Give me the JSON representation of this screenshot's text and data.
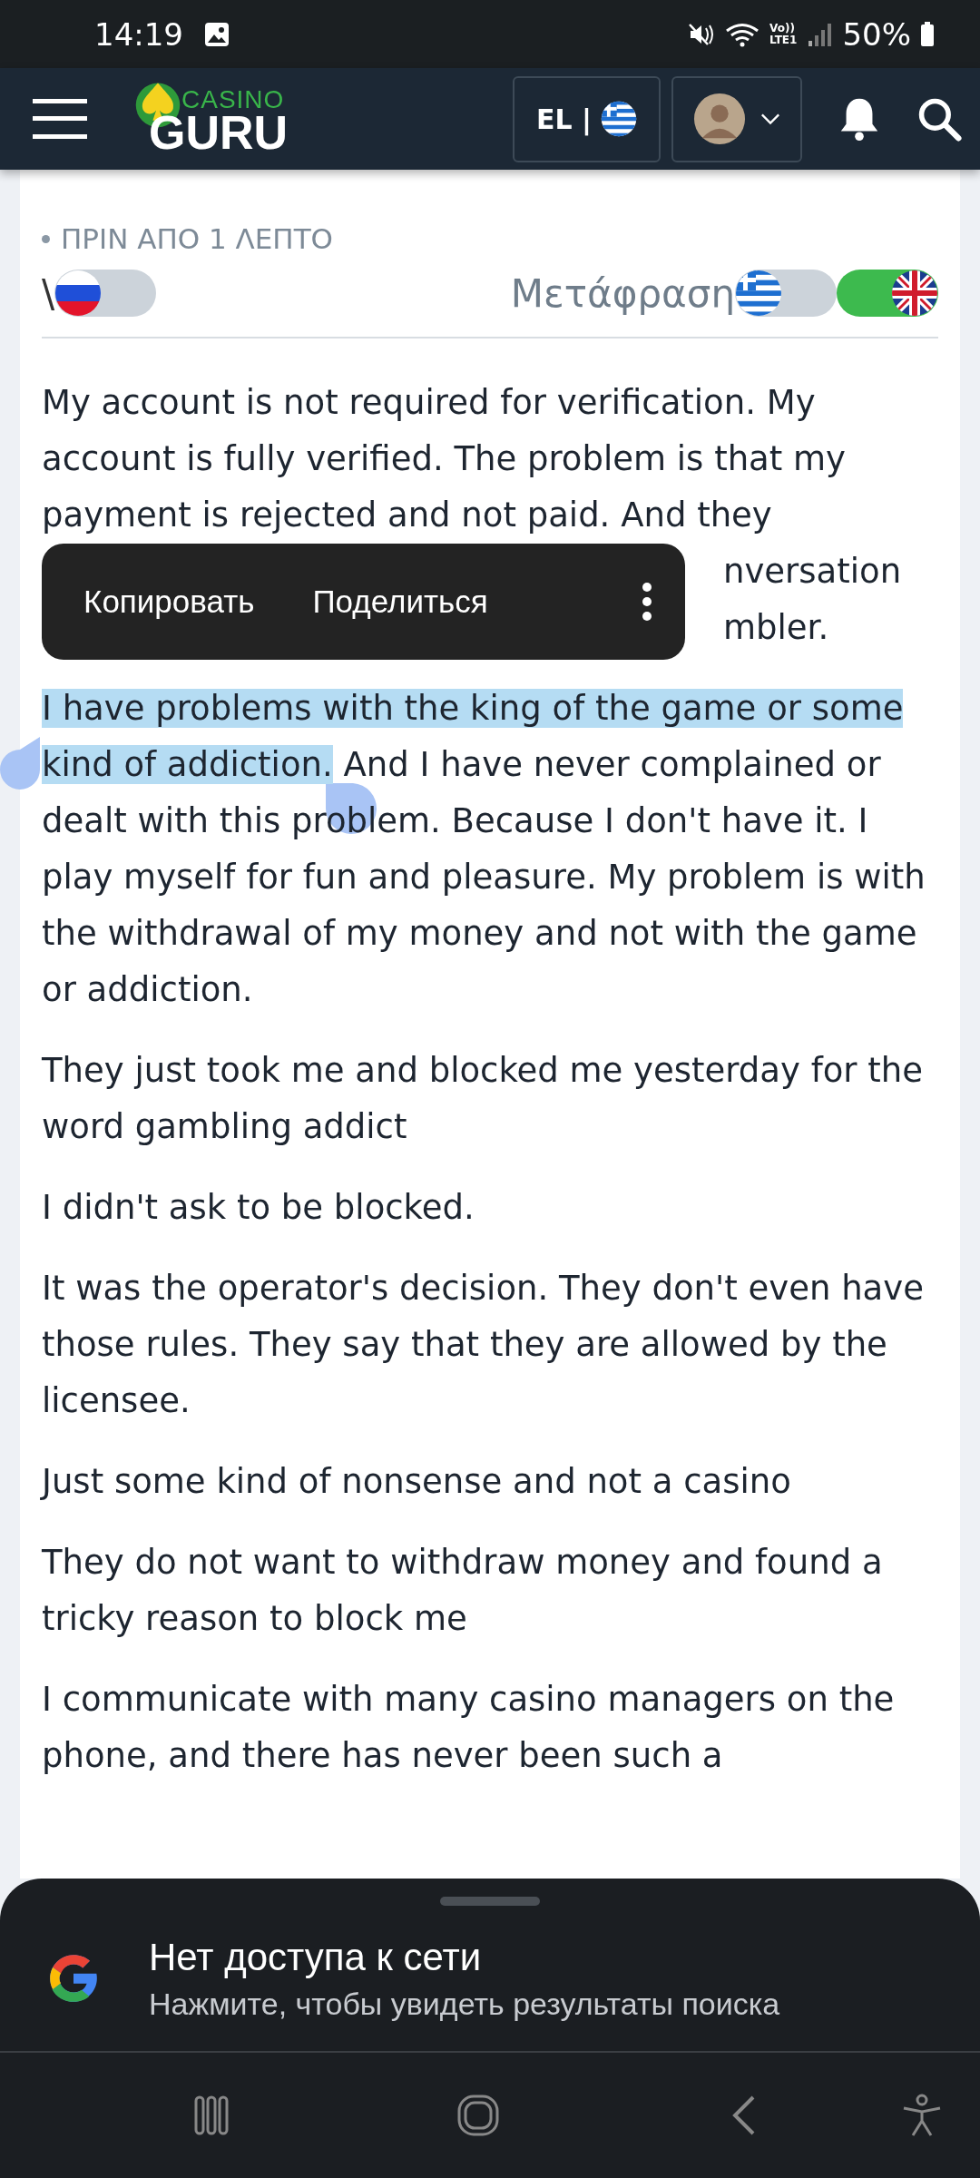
{
  "status_bar": {
    "time": "14:19",
    "volte_label": "Vo))",
    "network_label": "LTE1",
    "battery": "50%"
  },
  "header": {
    "logo_top": "CASINO",
    "logo_bottom": "GURU",
    "language": "EL |"
  },
  "comment": {
    "time": "ΠΡΙΝ ΑΠΟ 1 ΛΕΠΤΟ",
    "prefix": "\\",
    "translation_label": "Μετάφραση",
    "toggles": [
      {
        "kind": "ru",
        "on": false
      },
      {
        "kind": "gr",
        "on": false
      },
      {
        "kind": "gb",
        "on": true
      }
    ],
    "paragraphs": [
      {
        "kind": "covered",
        "text": "My account is not required for verification. My account is fully verified. The problem is that my payment is rejected and not paid. And they",
        "fragments": [
          "nversation",
          "mbler."
        ]
      },
      {
        "kind": "selected",
        "selected": "I have problems with the king of the game or some kind of addiction.",
        "text": " And I have never complained or dealt with this problem. Because I don't have it. I play myself for fun and pleasure. My problem is with the withdrawal of my money and not with the game or addiction."
      },
      {
        "kind": "plain",
        "text": "They just took me and blocked me yesterday for the word gambling addict"
      },
      {
        "kind": "plain",
        "text": "I didn't ask to be blocked."
      },
      {
        "kind": "plain",
        "text": "It was the operator's decision. They don't even have those rules. They say that they are allowed by the licensee."
      },
      {
        "kind": "plain",
        "text": "Just some kind of nonsense and not a casino"
      },
      {
        "kind": "plain",
        "text": "They do not want to withdraw money and found a tricky reason to block me"
      },
      {
        "kind": "plain",
        "text": "I communicate with many casino managers on the phone, and there has never been such a"
      }
    ]
  },
  "selection_menu": {
    "items": [
      {
        "kind": "text",
        "label": "Копировать"
      },
      {
        "kind": "text",
        "label": "Поделиться"
      },
      {
        "kind": "more"
      }
    ]
  },
  "bottom_sheet": {
    "title": "Нет доступа к сети",
    "subtitle": "Нажмите, чтобы увидеть результаты поиска"
  }
}
